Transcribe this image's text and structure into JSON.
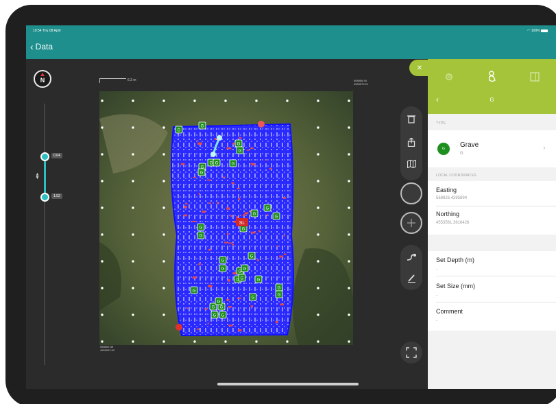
{
  "status": {
    "time": "19:54 Thu 08 April",
    "battery": "100%"
  },
  "nav": {
    "back_label": "Data"
  },
  "map": {
    "scale_label": "6.3 m",
    "coord_top_right": [
      "568856.94",
      "4553579.21"
    ],
    "coord_bottom_left": [
      "568800.38",
      "4553522.63"
    ],
    "depth_upper": "0.64",
    "depth_lower": "1.52"
  },
  "panel": {
    "title": "G",
    "type_section": "TYPE",
    "type_name": "Grave",
    "type_code": "G",
    "coords_section": "LOCAL COORDINATES",
    "easting_label": "Easting",
    "easting_value": "568826.4295894",
    "northing_label": "Northing",
    "northing_value": "4553561.3616426",
    "depth_label": "Set Depth (m)",
    "depth_value": "-",
    "size_label": "Set Size (mm)",
    "size_value": "-",
    "comment_label": "Comment",
    "comment_value": "-"
  },
  "map_markers": {
    "grave_label": "G",
    "sl_label": "SL"
  },
  "colors": {
    "teal": "#1e8f8c",
    "lime": "#a6c43a",
    "grave_green": "#1e8f1e",
    "survey_blue": "#1a1aff"
  },
  "icons": [
    "compass-icon",
    "trash-icon",
    "share-icon",
    "map-icon",
    "plus-icon",
    "path-icon",
    "pen-icon",
    "expand-icon",
    "gear-icon",
    "hand-icon",
    "panel-icon",
    "close-icon",
    "chevron-left-icon",
    "chevron-right-icon",
    "wifi-icon",
    "battery-icon"
  ]
}
